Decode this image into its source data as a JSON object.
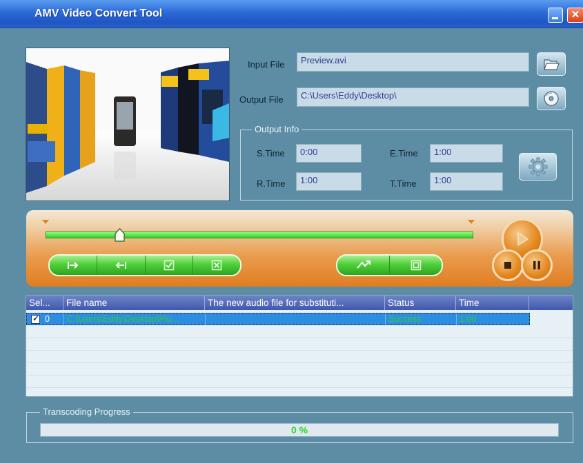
{
  "window": {
    "title": "AMV Video Convert Tool"
  },
  "input": {
    "label": "Input File",
    "value": "Preview.avi"
  },
  "output": {
    "label": "Output File",
    "value": "C:\\Users\\Eddy\\Desktop\\"
  },
  "output_info": {
    "title": "Output Info",
    "s_time": {
      "label": "S.Time",
      "value": "0:00"
    },
    "e_time": {
      "label": "E.Time",
      "value": "1:00"
    },
    "r_time": {
      "label": "R.Time",
      "value": "1:00"
    },
    "t_time": {
      "label": "T.Time",
      "value": "1:00"
    }
  },
  "slider": {
    "position_fraction": 0.175
  },
  "controls": {
    "left_group": [
      "mark-in",
      "mark-out",
      "check-all",
      "uncheck-all"
    ],
    "right_group": [
      "swap-audio",
      "fullscreen"
    ]
  },
  "list": {
    "columns": [
      "Sel...",
      "File name",
      "The new audio file for substituti...",
      "Status",
      "Time"
    ],
    "rows": [
      {
        "checked": true,
        "index": "0",
        "file": "C:\\Users\\Eddy\\Desktop\\Plu...",
        "audio": "",
        "status": "Success",
        "time": "1:00"
      }
    ]
  },
  "progress": {
    "title": "Transcoding Progress",
    "text": "0 %",
    "value": 0
  },
  "colors": {
    "accent_green": "#33cc33",
    "orange": "#e07d21",
    "titlebar": "#2b6ad6"
  }
}
